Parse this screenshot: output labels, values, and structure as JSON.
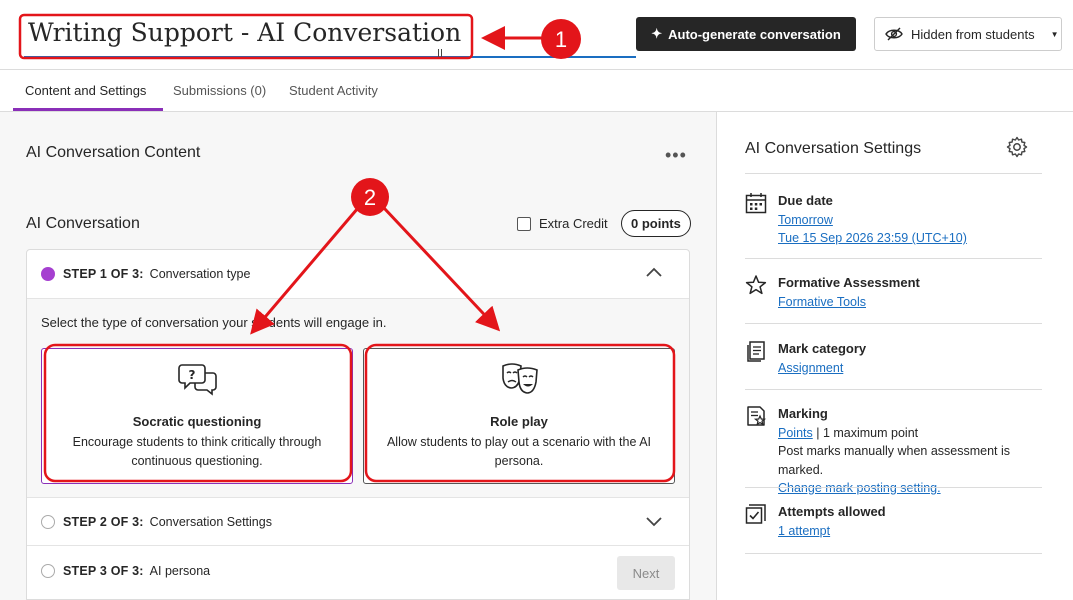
{
  "header": {
    "title": "Writing Support - AI Conversation",
    "autogen_label": "Auto-generate conversation",
    "visibility_label": "Hidden from students"
  },
  "tabs": [
    {
      "label": "Content and Settings",
      "active": true
    },
    {
      "label": "Submissions (0)",
      "active": false
    },
    {
      "label": "Student Activity",
      "active": false
    }
  ],
  "content": {
    "section_title": "AI Conversation Content",
    "conversation_title": "AI Conversation",
    "extra_credit_label": "Extra Credit",
    "points_label": "0 points",
    "steps": [
      {
        "label": "STEP 1 OF 3:",
        "name": "Conversation type"
      },
      {
        "label": "STEP 2 OF 3:",
        "name": "Conversation Settings"
      },
      {
        "label": "STEP 3 OF 3:",
        "name": "AI persona"
      }
    ],
    "step1_prompt": "Select the type of conversation your students will engage in.",
    "cards": [
      {
        "title": "Socratic questioning",
        "description": "Encourage students to think critically through continuous questioning."
      },
      {
        "title": "Role play",
        "description": "Allow students to play out a scenario with the AI persona."
      }
    ],
    "next_label": "Next"
  },
  "sidebar": {
    "title": "AI Conversation Settings",
    "due": {
      "heading": "Due date",
      "line1": "Tomorrow",
      "line2": "Tue 15 Sep 2026 23:59 (UTC+10)"
    },
    "formative": {
      "heading": "Formative Assessment",
      "link": "Formative Tools"
    },
    "category": {
      "heading": "Mark category",
      "link": "Assignment"
    },
    "marking": {
      "heading": "Marking",
      "link": "Points",
      "separator": " | ",
      "max": "1 maximum point",
      "note": "Post marks manually when assessment is marked.",
      "change_link": "Change mark posting setting."
    },
    "attempts": {
      "heading": "Attempts allowed",
      "link": "1 attempt"
    }
  },
  "annotations": {
    "badge1": "1",
    "badge2": "2",
    "color": "#e3151a"
  },
  "colors": {
    "accent_purple": "#8a2fb8",
    "link_blue": "#1a6ec1",
    "dark_button": "#262626"
  }
}
